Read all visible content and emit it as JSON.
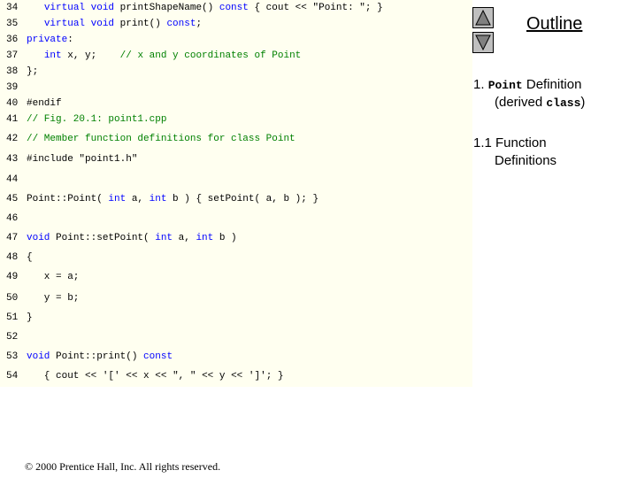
{
  "code_lines": [
    {
      "num": "34",
      "parts": [
        [
          "",
          "   "
        ],
        [
          "k",
          "virtual void "
        ],
        [
          "",
          "printShapeName() "
        ],
        [
          "k",
          "const"
        ],
        [
          "",
          " { cout << "
        ],
        [
          "s",
          "\"Point: \""
        ],
        [
          "",
          "; }"
        ]
      ]
    },
    {
      "num": "35",
      "parts": [
        [
          "",
          "   "
        ],
        [
          "k",
          "virtual void "
        ],
        [
          "",
          "print() "
        ],
        [
          "k",
          "const"
        ],
        [
          "",
          ";"
        ]
      ]
    },
    {
      "num": "36",
      "parts": [
        [
          "k",
          "private"
        ],
        [
          "",
          ":"
        ]
      ]
    },
    {
      "num": "37",
      "parts": [
        [
          "",
          "   "
        ],
        [
          "k",
          "int "
        ],
        [
          "",
          "x, y;    "
        ],
        [
          "c",
          "// x and y coordinates of Point"
        ]
      ]
    },
    {
      "num": "38",
      "parts": [
        [
          "",
          "};"
        ]
      ]
    },
    {
      "num": "39",
      "parts": []
    },
    {
      "num": "40",
      "parts": [
        [
          "pp",
          "#endif"
        ]
      ]
    },
    {
      "num": "41",
      "parts": [
        [
          "c",
          "// Fig. 20.1: point1.cpp"
        ]
      ]
    },
    {
      "num": "42",
      "parts": [
        [
          "c",
          "// Member function definitions for class Point"
        ]
      ]
    },
    {
      "num": "43",
      "parts": [
        [
          "pp",
          "#include "
        ],
        [
          "s",
          "\"point1.h\""
        ]
      ]
    },
    {
      "num": "44",
      "parts": []
    },
    {
      "num": "45",
      "parts": [
        [
          "",
          "Point::Point( "
        ],
        [
          "k",
          "int "
        ],
        [
          "",
          "a, "
        ],
        [
          "k",
          "int "
        ],
        [
          "",
          "b ) { setPoint( a, b ); }"
        ]
      ]
    },
    {
      "num": "46",
      "parts": []
    },
    {
      "num": "47",
      "parts": [
        [
          "k",
          "void "
        ],
        [
          "",
          "Point::setPoint( "
        ],
        [
          "k",
          "int "
        ],
        [
          "",
          "a, "
        ],
        [
          "k",
          "int "
        ],
        [
          "",
          "b )"
        ]
      ]
    },
    {
      "num": "48",
      "parts": [
        [
          "",
          "{"
        ]
      ]
    },
    {
      "num": "49",
      "parts": [
        [
          "",
          "   x = a;"
        ]
      ]
    },
    {
      "num": "50",
      "parts": [
        [
          "",
          "   y = b;"
        ]
      ]
    },
    {
      "num": "51",
      "parts": [
        [
          "",
          "}"
        ]
      ]
    },
    {
      "num": "52",
      "parts": []
    },
    {
      "num": "53",
      "parts": [
        [
          "k",
          "void "
        ],
        [
          "",
          "Point::print() "
        ],
        [
          "k",
          "const"
        ]
      ]
    },
    {
      "num": "54",
      "parts": [
        [
          "",
          "   { cout << "
        ],
        [
          "s",
          "'['"
        ],
        [
          "",
          " << x << "
        ],
        [
          "s",
          "\", \""
        ],
        [
          "",
          " << y << "
        ],
        [
          "s",
          "']'"
        ],
        [
          "",
          "; }"
        ]
      ]
    }
  ],
  "outline": {
    "title": "Outline",
    "item1_num": "1.",
    "item1_code": "Point",
    "item1_text": " Definition",
    "item1_text2": "(derived ",
    "item1_code2": "class",
    "item1_text3": ")",
    "item2_line1": "1.1 Function",
    "item2_line2": "Definitions"
  },
  "nav": {
    "up_icon": "triangle-up-icon",
    "down_icon": "triangle-down-icon"
  },
  "footer": "© 2000 Prentice Hall, Inc.  All rights reserved."
}
